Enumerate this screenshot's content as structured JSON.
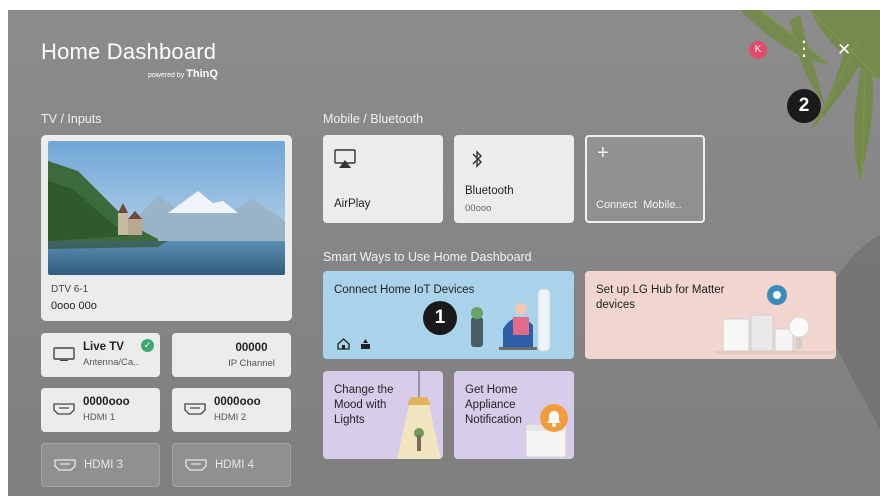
{
  "header": {
    "title": "Home Dashboard",
    "powered_prefix": "powered by",
    "powered_brand": "ThinQ",
    "avatar_letter": "K",
    "more_glyph": "⋮",
    "close_glyph": "✕"
  },
  "sections": {
    "tv_inputs": "TV / Inputs",
    "mobile": "Mobile / Bluetooth",
    "smart": "Smart Ways to Use Home Dashboard"
  },
  "tv": {
    "channel": "DTV 6-1",
    "program": "0ooo 00o"
  },
  "inputs": [
    {
      "main": "Live TV",
      "sub": "Antenna/Ca..",
      "icon": "tv-icon",
      "checked": true
    },
    {
      "main": "00000",
      "sub": "IP Channel"
    },
    {
      "main": "0000ooo",
      "sub": "HDMI 1",
      "icon": "hdmi-icon"
    },
    {
      "main": "0000ooo",
      "sub": "HDMI 2",
      "icon": "hdmi-icon"
    },
    {
      "main": "HDMI 3",
      "icon": "hdmi-icon",
      "dim": true
    },
    {
      "main": "HDMI 4",
      "icon": "hdmi-icon",
      "dim": true
    }
  ],
  "mobile": [
    {
      "label": "AirPlay",
      "icon": "airplay-icon"
    },
    {
      "label": "Bluetooth",
      "sub": "00ooo",
      "icon": "bluetooth-icon"
    },
    {
      "label": "Connect  Mobile..",
      "icon": "plus-icon"
    }
  ],
  "smart": [
    {
      "title": "Connect Home IoT Devices",
      "color": "#a9d3ea"
    },
    {
      "title": "Set up LG Hub for Matter devices",
      "color": "#f3d5d0"
    },
    {
      "title": "Change the Mood with Lights",
      "color": "#d7cdeb"
    },
    {
      "title": "Get Home Appliance Notification",
      "color": "#d7cdeb"
    }
  ],
  "callouts": {
    "one": "1",
    "two": "2"
  },
  "colors": {
    "background": "#858585",
    "card": "#ececec",
    "avatar": "#e24b6d",
    "check": "#3ea872",
    "bell": "#f39c3c"
  }
}
